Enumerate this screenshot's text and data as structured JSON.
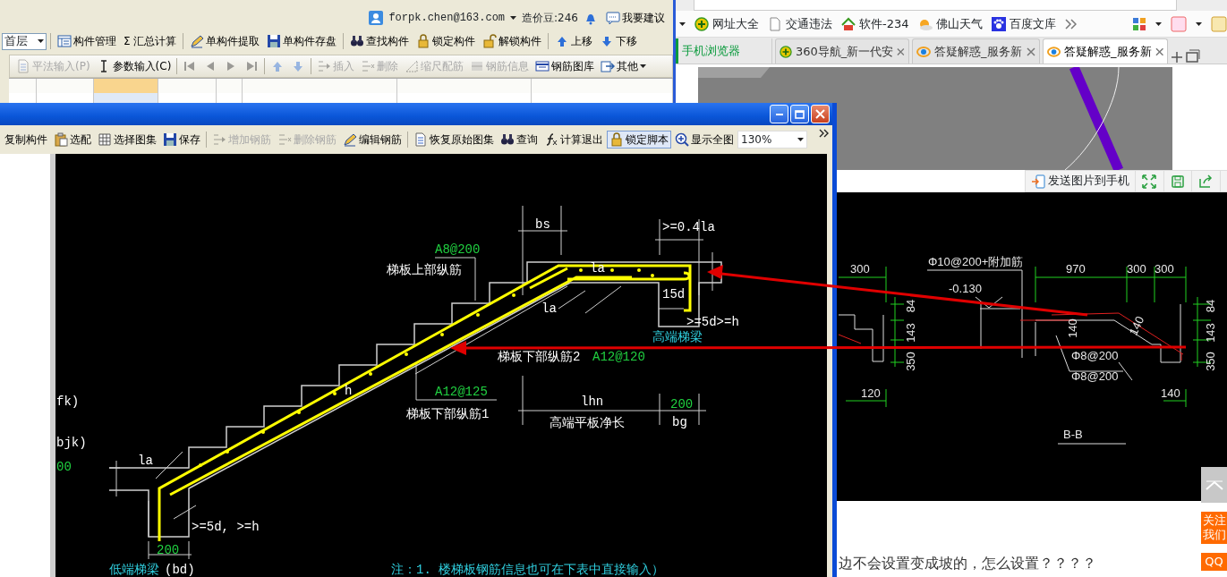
{
  "app_window": {
    "account": {
      "email": "forpk.chen@163.com",
      "beans": "造价豆:246",
      "feedback": "我要建议"
    },
    "floor_select": {
      "value": "首层"
    },
    "toolbar": [
      {
        "label": "构件管理"
      },
      {
        "symbol": "Σ",
        "label": "汇总计算"
      },
      {
        "label": "单构件提取"
      },
      {
        "label": "单构件存盘"
      },
      {
        "label": "查找构件"
      },
      {
        "label": "锁定构件"
      },
      {
        "label": "解锁构件"
      },
      {
        "label": "上移"
      },
      {
        "label": "下移"
      }
    ],
    "toolbar2": [
      {
        "kind": "text",
        "label": "平法输入(P)",
        "disabled": true
      },
      {
        "kind": "text",
        "label": "参数输入(C)",
        "disabled": false
      },
      {
        "kind": "icon",
        "disabled": true
      },
      {
        "kind": "icon",
        "disabled": true
      },
      {
        "kind": "icon",
        "disabled": true
      },
      {
        "kind": "icon",
        "disabled": true
      },
      {
        "kind": "icon",
        "disabled": true
      },
      {
        "kind": "icon",
        "disabled": true
      },
      {
        "kind": "text",
        "label": "插入",
        "disabled": true
      },
      {
        "kind": "text",
        "label": "删除",
        "disabled": true
      },
      {
        "kind": "text",
        "label": "缩尺配筋",
        "disabled": true
      },
      {
        "kind": "text",
        "label": "钢筋信息",
        "disabled": true
      },
      {
        "kind": "text",
        "label": "钢筋图库",
        "disabled": false
      },
      {
        "kind": "menu",
        "label": "其他",
        "disabled": false
      }
    ],
    "grid_columns": [
      {
        "selected": false
      },
      {
        "selected": false
      },
      {
        "selected": true
      },
      {
        "selected": false
      },
      {
        "selected": false
      },
      {
        "selected": false
      },
      {
        "selected": false
      },
      {
        "selected": false
      }
    ]
  },
  "browser": {
    "bookmarks": [
      "网址大全",
      "交通违法",
      "软件-234",
      "佛山天气",
      "百度文库"
    ],
    "sidebar_label": "手机浏览器",
    "tabs": [
      {
        "label": "360导航_新一代安",
        "selected": false
      },
      {
        "label": "答疑解惑_服务新",
        "selected": false
      },
      {
        "label": "答疑解惑_服务新",
        "selected": true
      }
    ],
    "photo_toolbar": {
      "send": "发送图片到手机"
    },
    "cad_labels": [
      "300",
      "Φ10@200+附加筋",
      "-0.130",
      "970",
      "300",
      "300",
      "Φ8@200",
      "Φ8@200",
      "120",
      "140",
      "B-B",
      "84",
      "143",
      "350",
      "84",
      "143",
      "350",
      "140",
      "140"
    ],
    "question": "边不会设置变成坡的，怎么设置？？？？",
    "side_buttons": [
      {
        "kind": "top"
      },
      {
        "kind": "text",
        "label": "关注我们"
      },
      {
        "kind": "text",
        "label": "QQ"
      }
    ]
  },
  "dialog": {
    "toolbar": [
      {
        "label": "复制构件",
        "disabled": false,
        "pressed": false
      },
      {
        "label": "选配",
        "disabled": false,
        "pressed": false
      },
      {
        "label": "选择图集",
        "disabled": false,
        "pressed": false
      },
      {
        "label": "保存",
        "disabled": false,
        "pressed": false
      },
      {
        "label": "增加钢筋",
        "disabled": true,
        "pressed": false
      },
      {
        "label": "删除钢筋",
        "disabled": true,
        "pressed": false
      },
      {
        "label": "编辑钢筋",
        "disabled": false,
        "pressed": false
      },
      {
        "label": "恢复原始图集",
        "disabled": false,
        "pressed": false
      },
      {
        "label": "查询",
        "disabled": false,
        "pressed": false
      },
      {
        "label": "计算退出",
        "disabled": false,
        "pressed": false
      },
      {
        "label": "锁定脚本",
        "disabled": false,
        "pressed": true
      },
      {
        "label": "显示全图",
        "disabled": false,
        "pressed": false
      }
    ],
    "zoom": "130%",
    "drawing_labels": [
      {
        "text": "A8@200",
        "kind": "spec"
      },
      {
        "text": "梯板上部纵筋",
        "kind": "dim"
      },
      {
        "text": "bs",
        "kind": "dim"
      },
      {
        "text": ">=0.4la",
        "kind": "dim"
      },
      {
        "text": "la",
        "kind": "dim"
      },
      {
        "text": "la",
        "kind": "dim"
      },
      {
        "text": "15d",
        "kind": "dim"
      },
      {
        "text": ">=5d>=h",
        "kind": "dim"
      },
      {
        "text": "高端梯梁",
        "kind": "beam"
      },
      {
        "text": "梯板下部纵筋2",
        "kind": "dim"
      },
      {
        "text": "A12@120",
        "kind": "spec"
      },
      {
        "text": "A12@125",
        "kind": "spec"
      },
      {
        "text": "梯板下部纵筋1",
        "kind": "dim"
      },
      {
        "text": "lhn",
        "kind": "dim"
      },
      {
        "text": "高端平板净长",
        "kind": "dim"
      },
      {
        "text": "200",
        "kind": "spec"
      },
      {
        "text": "bg",
        "kind": "dim"
      },
      {
        "text": "h",
        "kind": "dim"
      },
      {
        "text": "la",
        "kind": "dim"
      },
      {
        "text": ">=5d, >=h",
        "kind": "dim"
      },
      {
        "text": "200",
        "kind": "spec"
      },
      {
        "text": "低端梯梁",
        "kind": "beam"
      },
      {
        "text": "(bd)",
        "kind": "dim"
      },
      {
        "text": "fk)",
        "kind": "dim"
      },
      {
        "text": "bjk)",
        "kind": "dim"
      },
      {
        "text": "00",
        "kind": "spec"
      },
      {
        "text": "注：1. 楼梯板钢筋信息也可在下表中直接输入）",
        "kind": "note"
      }
    ]
  }
}
